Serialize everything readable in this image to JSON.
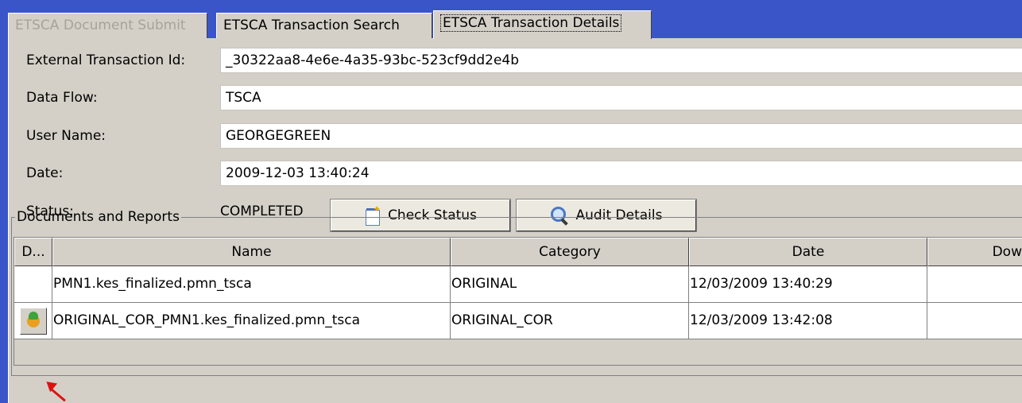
{
  "tabs": [
    {
      "label": "ETSCA Document Submit",
      "state": "disabled"
    },
    {
      "label": "ETSCA Transaction Search",
      "state": "normal"
    },
    {
      "label": "ETSCA Transaction Details",
      "state": "active"
    }
  ],
  "fields": {
    "external_transaction_id": {
      "label": "External Transaction Id:",
      "value": "_30322aa8-4e6e-4a35-93bc-523cf9dd2e4b"
    },
    "data_flow": {
      "label": "Data Flow:",
      "value": "TSCA"
    },
    "user_name": {
      "label": "User Name:",
      "value": "GEORGEGREEN"
    },
    "date": {
      "label": "Date:",
      "value": "2009-12-03 13:40:24"
    },
    "status": {
      "label": "Status:",
      "value": "COMPLETED"
    }
  },
  "buttons": {
    "check_status": {
      "label": "Check Status",
      "icon": "check-status-icon"
    },
    "audit_details": {
      "label": "Audit Details",
      "icon": "magnifier-icon"
    }
  },
  "documents": {
    "legend": "Documents and Reports",
    "columns": [
      "D...",
      "Name",
      "Category",
      "Date",
      "Dow"
    ],
    "rows": [
      {
        "name": "PMN1.kes_finalized.pmn_tsca",
        "category": "ORIGINAL",
        "date": "12/03/2009 13:40:29",
        "has_download": false
      },
      {
        "name": "ORIGINAL_COR_PMN1.kes_finalized.pmn_tsca",
        "category": "ORIGINAL_COR",
        "date": "12/03/2009 13:42:08",
        "has_download": true
      }
    ]
  },
  "colors": {
    "background": "#3a55c8",
    "panel": "#d4d0c8",
    "annotation_arrow": "#e01010"
  }
}
